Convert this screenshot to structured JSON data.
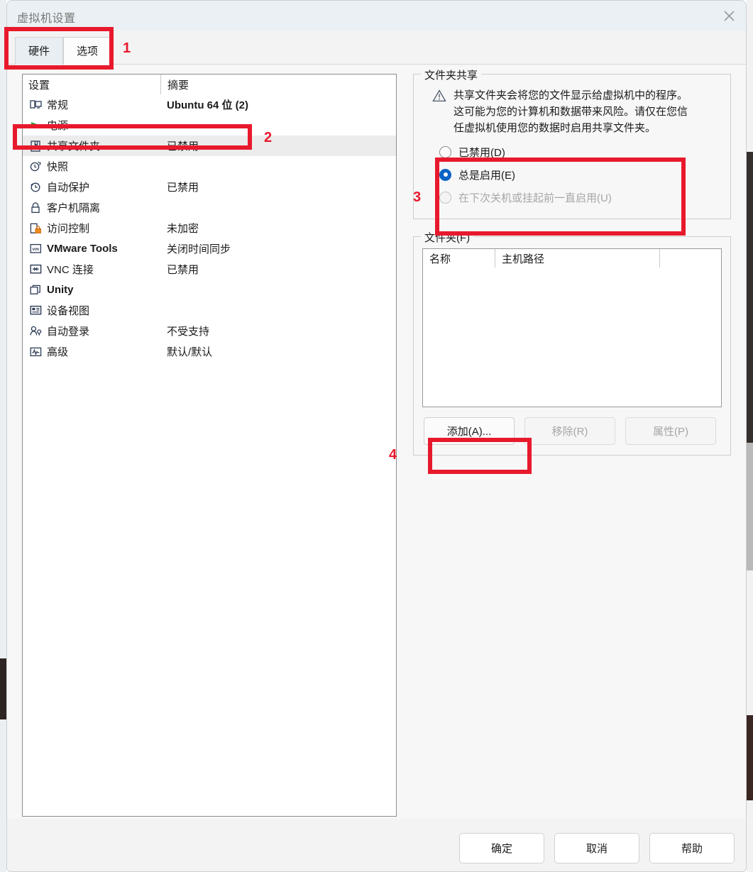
{
  "window": {
    "title": "虚拟机设置",
    "close_icon": "close-icon"
  },
  "tabs": [
    {
      "label": "硬件",
      "active": false
    },
    {
      "label": "选项",
      "active": true
    }
  ],
  "settings_list": {
    "columns": [
      "设置",
      "摘要"
    ],
    "rows": [
      {
        "icon": "monitor-icon",
        "label": "常规",
        "summary": "Ubuntu 64 位 (2)",
        "bold_summary": true,
        "selected": false
      },
      {
        "icon": "power-play-icon",
        "label": "电源",
        "summary": "",
        "bold_summary": false,
        "selected": false
      },
      {
        "icon": "shared-folder-icon",
        "label": "共享文件夹",
        "summary": "已禁用",
        "bold_summary": false,
        "selected": true
      },
      {
        "icon": "snapshot-clock-icon",
        "label": "快照",
        "summary": "",
        "bold_summary": false,
        "selected": false
      },
      {
        "icon": "autoprotect-icon",
        "label": "自动保护",
        "summary": "已禁用",
        "bold_summary": false,
        "selected": false
      },
      {
        "icon": "lock-icon",
        "label": "客户机隔离",
        "summary": "",
        "bold_summary": false,
        "selected": false
      },
      {
        "icon": "access-control-icon",
        "label": "访问控制",
        "summary": "未加密",
        "bold_summary": false,
        "selected": false
      },
      {
        "icon": "vmware-tools-icon",
        "label": "VMware Tools",
        "summary": "关闭时间同步",
        "bold_summary": false,
        "selected": false,
        "bold_label": true
      },
      {
        "icon": "vnc-icon",
        "label": "VNC 连接",
        "summary": "已禁用",
        "bold_summary": false,
        "selected": false
      },
      {
        "icon": "unity-icon",
        "label": "Unity",
        "summary": "",
        "bold_summary": false,
        "selected": false,
        "bold_label": true
      },
      {
        "icon": "device-view-icon",
        "label": "设备视图",
        "summary": "",
        "bold_summary": false,
        "selected": false
      },
      {
        "icon": "autologin-icon",
        "label": "自动登录",
        "summary": "不受支持",
        "bold_summary": false,
        "selected": false
      },
      {
        "icon": "advanced-icon",
        "label": "高级",
        "summary": "默认/默认",
        "bold_summary": false,
        "selected": false
      }
    ]
  },
  "folder_sharing": {
    "group_title": "文件夹共享",
    "warning_icon": "warning-triangle-icon",
    "warning_text": "共享文件夹会将您的文件显示给虚拟机中的程序。这可能为您的计算机和数据带来风险。请仅在您信任虚拟机使用您的数据时启用共享文件夹。",
    "options": [
      {
        "label": "已禁用(D)",
        "checked": false,
        "disabled": false
      },
      {
        "label": "总是启用(E)",
        "checked": true,
        "disabled": false
      },
      {
        "label": "在下次关机或挂起前一直启用(U)",
        "checked": false,
        "disabled": true
      }
    ]
  },
  "folders": {
    "group_title": "文件夹(F)",
    "columns": [
      "名称",
      "主机路径"
    ],
    "rows": [],
    "buttons": [
      {
        "label": "添加(A)...",
        "disabled": false
      },
      {
        "label": "移除(R)",
        "disabled": true
      },
      {
        "label": "属性(P)",
        "disabled": true
      }
    ]
  },
  "footer_buttons": [
    {
      "label": "确定"
    },
    {
      "label": "取消"
    },
    {
      "label": "帮助"
    }
  ],
  "annotations": [
    {
      "number": "1"
    },
    {
      "number": "2"
    },
    {
      "number": "3"
    },
    {
      "number": "4"
    }
  ],
  "colors": {
    "annotation_red": "#e8192c",
    "radio_blue": "#0b62c4",
    "title_gray": "#777777"
  }
}
